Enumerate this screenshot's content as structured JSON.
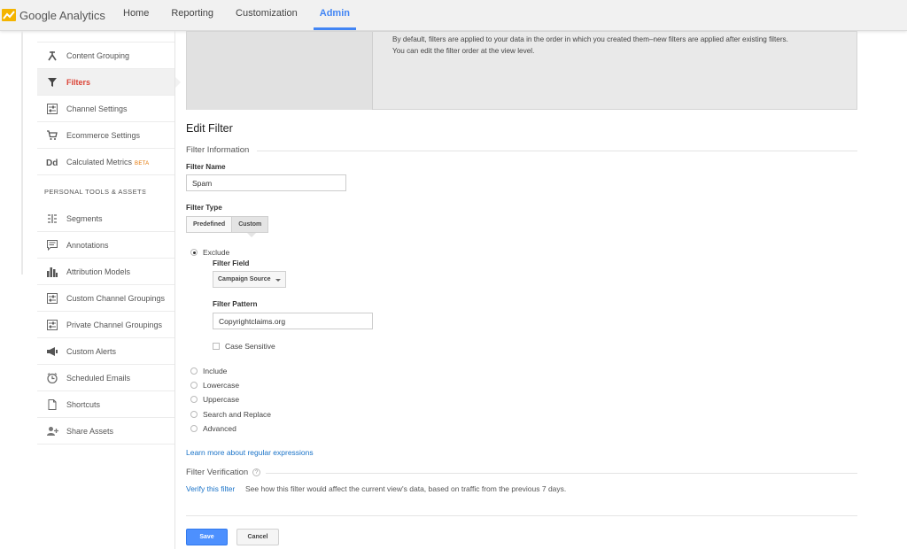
{
  "app": {
    "brand": "Google Analytics"
  },
  "nav": {
    "tabs": [
      "Home",
      "Reporting",
      "Customization",
      "Admin"
    ],
    "active": "Admin"
  },
  "sidebar": {
    "view_items": [
      {
        "label": "Content Grouping",
        "icon": "content-grouping-icon"
      },
      {
        "label": "Filters",
        "icon": "filter-icon",
        "active": true
      },
      {
        "label": "Channel Settings",
        "icon": "channel-settings-icon"
      },
      {
        "label": "Ecommerce Settings",
        "icon": "cart-icon"
      },
      {
        "label": "Calculated Metrics",
        "icon": "calculated-metrics-icon",
        "badge": "BETA"
      }
    ],
    "section_heading": "PERSONAL TOOLS & ASSETS",
    "tool_items": [
      {
        "label": "Segments",
        "icon": "segments-icon"
      },
      {
        "label": "Annotations",
        "icon": "annotations-icon"
      },
      {
        "label": "Attribution Models",
        "icon": "bar-chart-icon"
      },
      {
        "label": "Custom Channel Groupings",
        "icon": "channel-grouping-icon"
      },
      {
        "label": "Private Channel Groupings",
        "icon": "channel-grouping-icon"
      },
      {
        "label": "Custom Alerts",
        "icon": "megaphone-icon"
      },
      {
        "label": "Scheduled Emails",
        "icon": "clock-icon"
      },
      {
        "label": "Shortcuts",
        "icon": "document-icon"
      },
      {
        "label": "Share Assets",
        "icon": "add-person-icon"
      }
    ]
  },
  "notice": {
    "line1": "By default, filters are applied to your data in the order in which you created them–new filters are applied after existing filters.",
    "line2": "You can edit the filter order at the view level."
  },
  "form": {
    "title": "Edit Filter",
    "info_section": "Filter Information",
    "name_label": "Filter Name",
    "name_value": "Spam",
    "type_label": "Filter Type",
    "type_options": [
      "Predefined",
      "Custom"
    ],
    "type_selected": "Custom",
    "mode_options": [
      "Exclude",
      "Include",
      "Lowercase",
      "Uppercase",
      "Search and Replace",
      "Advanced"
    ],
    "mode_selected": "Exclude",
    "field_label": "Filter Field",
    "field_value": "Campaign Source",
    "pattern_label": "Filter Pattern",
    "pattern_value": "Copyrightclaims.org",
    "case_sensitive_label": "Case Sensitive",
    "regex_link": "Learn more about regular expressions",
    "verification_section": "Filter Verification",
    "help_glyph": "?",
    "verify_link": "Verify this filter",
    "verify_desc": "See how this filter would affect the current view's data, based on traffic from the previous 7 days.",
    "save_label": "Save",
    "cancel_label": "Cancel"
  },
  "colors": {
    "accent": "#4285f4",
    "active_red": "#db4437",
    "link": "#1a73c8",
    "save_button": "#4d90fe"
  }
}
